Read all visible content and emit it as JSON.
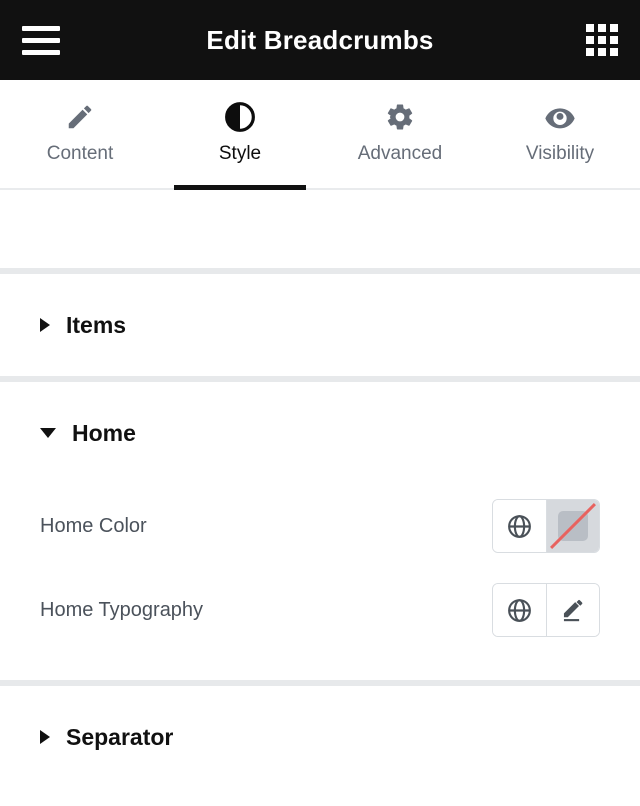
{
  "header": {
    "title": "Edit Breadcrumbs",
    "menu_icon": "hamburger-icon",
    "apps_icon": "grid-icon"
  },
  "tabs": [
    {
      "label": "Content",
      "icon": "pencil-icon",
      "active": false
    },
    {
      "label": "Style",
      "icon": "contrast-icon",
      "active": true
    },
    {
      "label": "Advanced",
      "icon": "gear-icon",
      "active": false
    },
    {
      "label": "Visibility",
      "icon": "eye-icon",
      "active": false
    }
  ],
  "sections": [
    {
      "title": "Items",
      "state": "collapsed"
    },
    {
      "title": "Home",
      "state": "expanded"
    },
    {
      "title": "Separator",
      "state": "collapsed"
    }
  ],
  "controls": [
    {
      "label": "Home Color",
      "buttons": [
        {
          "icon": "globe-icon",
          "type": "globe"
        },
        {
          "icon": "no-color-swatch-icon",
          "type": "swatch-empty"
        }
      ]
    },
    {
      "label": "Home Typography",
      "buttons": [
        {
          "icon": "globe-icon",
          "type": "globe"
        },
        {
          "icon": "edit-pencil-icon",
          "type": "pencil"
        }
      ]
    }
  ],
  "colors": {
    "header_bg": "#111111",
    "header_text": "#ffffff",
    "tab_active": "#0d0d0d",
    "tab_inactive": "#666d78",
    "divider": "#e7e9eb",
    "label_text": "#4b525b",
    "icon_slate": "#4a5158",
    "swatch_bg": "#d6d9dd",
    "swatch_inner": "#b9bec5",
    "slash_red": "#e8635f",
    "control_border": "#d9dde1"
  }
}
